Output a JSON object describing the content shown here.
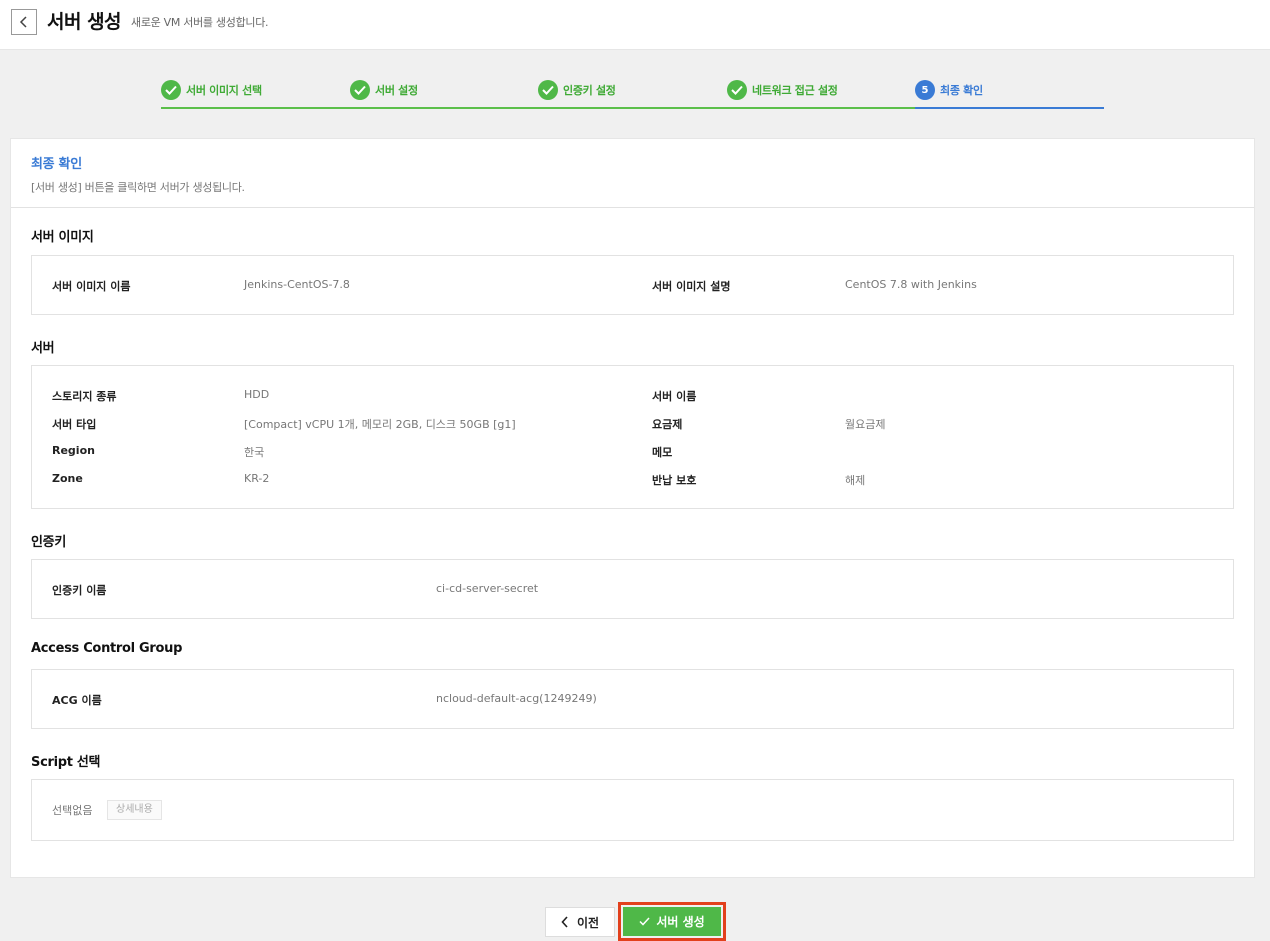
{
  "header": {
    "title": "서버 생성",
    "subtitle": "새로운 VM 서버를 생성합니다."
  },
  "steps": [
    {
      "label": "서버 이미지 선택",
      "state": "done"
    },
    {
      "label": "서버 설정",
      "state": "done"
    },
    {
      "label": "인증키 설정",
      "state": "done"
    },
    {
      "label": "네트워크 접근 설정",
      "state": "done"
    },
    {
      "label": "최종 확인",
      "state": "active",
      "number": "5"
    }
  ],
  "panel": {
    "title": "최종 확인",
    "description": "[서버 생성] 버튼을 클릭하면 서버가 생성됩니다."
  },
  "server_image": {
    "title": "서버 이미지",
    "name_label": "서버 이미지 이름",
    "name_value": "Jenkins-CentOS-7.8",
    "desc_label": "서버 이미지 설명",
    "desc_value": "CentOS 7.8 with Jenkins"
  },
  "server": {
    "title": "서버",
    "storage_label": "스토리지 종류",
    "storage_value": "HDD",
    "type_label": "서버 타입",
    "type_value": "[Compact] vCPU 1개, 메모리 2GB, 디스크 50GB [g1]",
    "region_label": "Region",
    "region_value": "한국",
    "zone_label": "Zone",
    "zone_value": "KR-2",
    "name_label": "서버 이름",
    "name_value": "",
    "plan_label": "요금제",
    "plan_value": "월요금제",
    "memo_label": "메모",
    "memo_value": "",
    "protect_label": "반납 보호",
    "protect_value": "해제"
  },
  "auth_key": {
    "title": "인증키",
    "name_label": "인증키 이름",
    "name_value": "ci-cd-server-secret"
  },
  "acg": {
    "title": "Access Control Group",
    "name_label": "ACG 이름",
    "name_value": "ncloud-default-acg(1249249)"
  },
  "script": {
    "title": "Script 선택",
    "value": "선택없음",
    "detail_button": "상세내용"
  },
  "footer": {
    "prev_label": "이전",
    "create_label": "서버 생성"
  },
  "colors": {
    "accent_blue": "#3a7bd5",
    "success_green": "#4fb848",
    "highlight_red": "#e2401c"
  }
}
